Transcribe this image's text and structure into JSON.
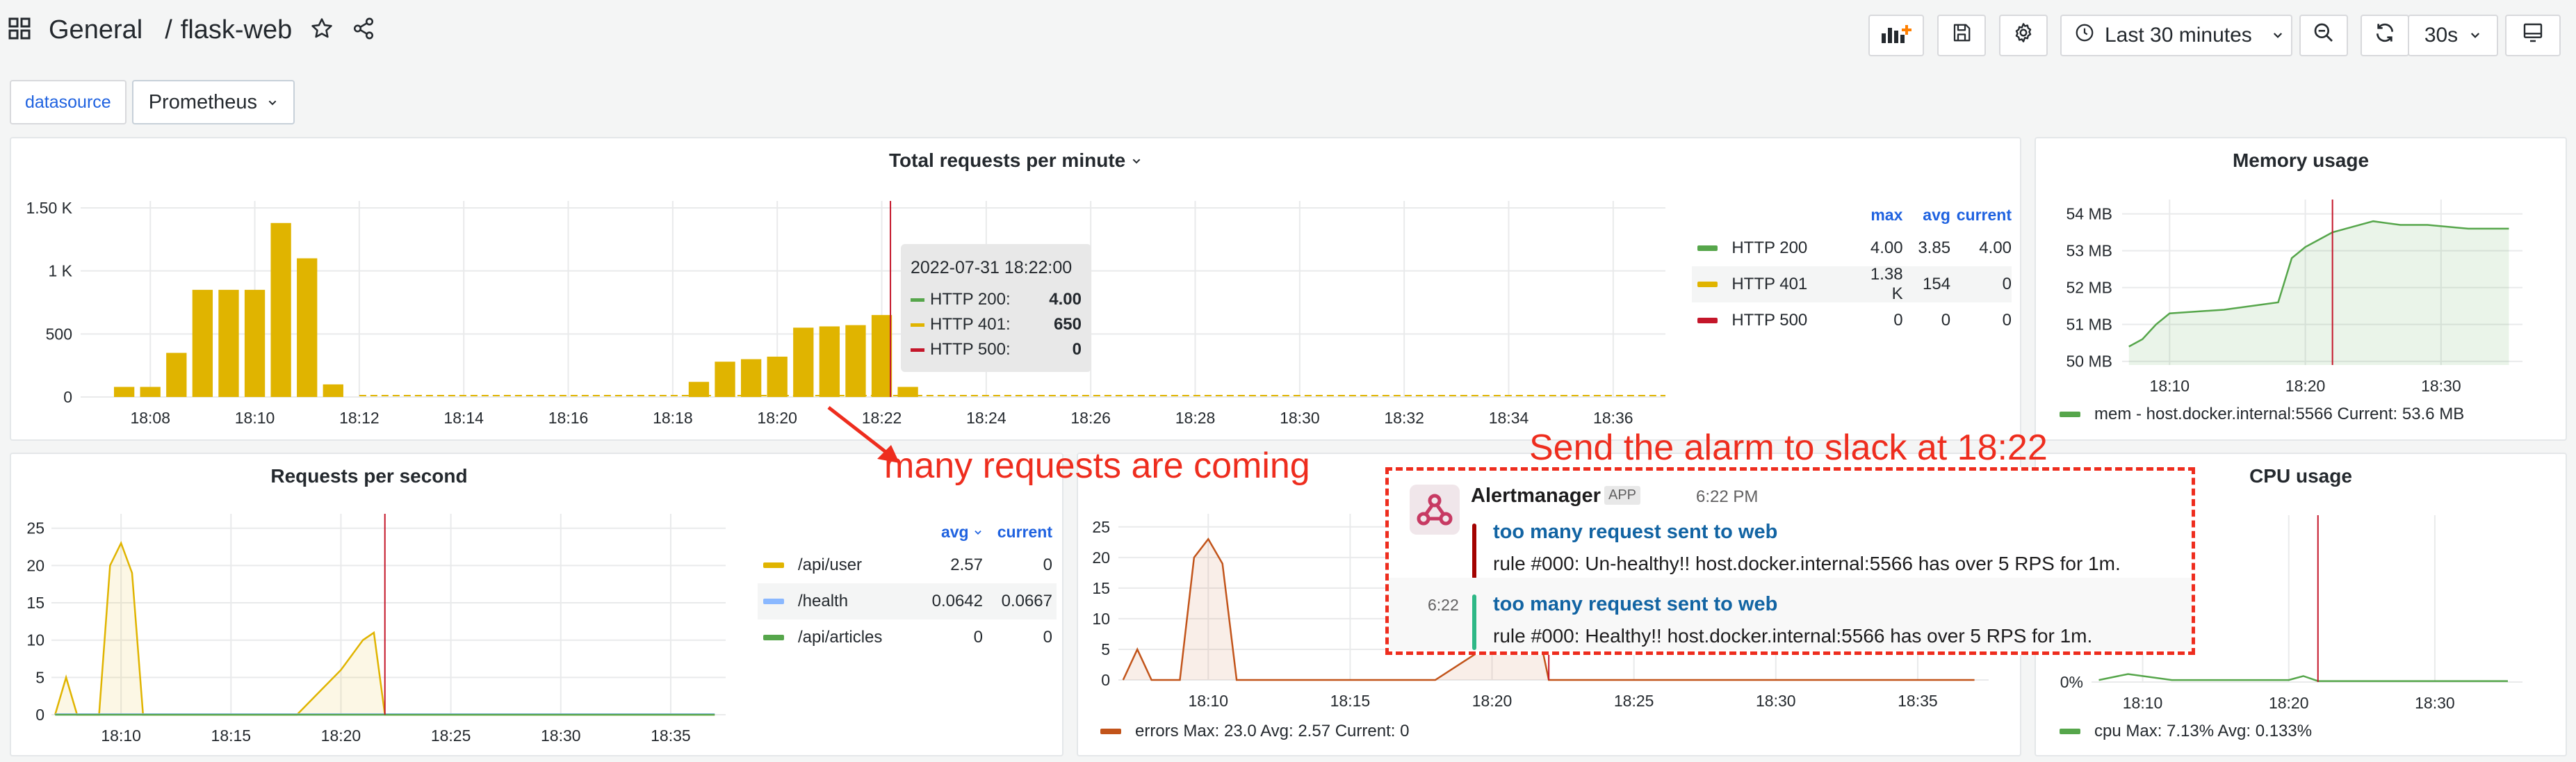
{
  "header": {
    "folder": "General",
    "separator": "/",
    "dashboard": "flask-web",
    "time_range": "Last 30 minutes",
    "refresh": "30s"
  },
  "variables": {
    "label": "datasource",
    "value": "Prometheus"
  },
  "icons": [
    "apps-icon",
    "star-icon",
    "share-icon",
    "add-panel-icon",
    "save-icon",
    "gear-icon",
    "clock-icon",
    "chevron-down-icon",
    "zoom-out-icon",
    "refresh-icon",
    "tv-icon"
  ],
  "panels": {
    "total_requests": {
      "title": "Total requests per minute",
      "legend": {
        "headers": [
          "max",
          "avg",
          "current"
        ],
        "rows": [
          {
            "name": "HTTP 200",
            "max": "4.00",
            "avg": "3.85",
            "current": "4.00",
            "color": "#56a64b"
          },
          {
            "name": "HTTP 401",
            "max": "1.38 K",
            "avg": "154",
            "current": "0",
            "color": "#e0b400"
          },
          {
            "name": "HTTP 500",
            "max": "0",
            "avg": "0",
            "current": "0",
            "color": "#c4162a"
          }
        ]
      },
      "tooltip": {
        "time": "2022-07-31 18:22:00",
        "rows": [
          {
            "label": "HTTP 200:",
            "value": "4.00",
            "color": "#56a64b"
          },
          {
            "label": "HTTP 401:",
            "value": "650",
            "color": "#e0b400"
          },
          {
            "label": "HTTP 500:",
            "value": "0",
            "color": "#c4162a"
          }
        ]
      }
    },
    "memory": {
      "title": "Memory usage",
      "legend": "mem - host.docker.internal:5566  Current: 53.6 MB"
    },
    "rps": {
      "title": "Requests per second",
      "legend": {
        "headers": [
          "avg",
          "current"
        ],
        "rows": [
          {
            "name": "/api/user",
            "avg": "2.57",
            "current": "0",
            "color": "#e0b400"
          },
          {
            "name": "/health",
            "avg": "0.0642",
            "current": "0.0667",
            "color": "#8ab8ff"
          },
          {
            "name": "/api/articles",
            "avg": "0",
            "current": "0",
            "color": "#56a64b"
          }
        ]
      }
    },
    "errors": {
      "legend": "errors  Max: 23.0  Avg: 2.57  Current: 0"
    },
    "cpu": {
      "title": "CPU usage",
      "legend": "cpu  Max: 7.13%  Avg: 0.133%"
    }
  },
  "annotations": {
    "arrow_text": "many requests are coming",
    "slack_text": "Send the alarm to slack at 18:22"
  },
  "slack": {
    "sender": "Alertmanager",
    "badge": "APP",
    "time": "6:22 PM",
    "messages": [
      {
        "title": "too many request sent to web",
        "body": "rule #000:  Un-healthy!!  host.docker.internal:5566 has over 5 RPS for 1m.",
        "bar_color": "#a30200",
        "stamp": ""
      },
      {
        "title": "too many request sent to web",
        "body": "rule #000:  Healthy!!  host.docker.internal:5566 has over 5 RPS for 1m.",
        "bar_color": "#2eb886",
        "stamp": "6:22"
      }
    ]
  },
  "chart_data": [
    {
      "type": "bar",
      "title": "Total requests per minute",
      "x_ticks": [
        "18:08",
        "18:10",
        "18:12",
        "18:14",
        "18:16",
        "18:18",
        "18:20",
        "18:22",
        "18:24",
        "18:26",
        "18:28",
        "18:30",
        "18:32",
        "18:34",
        "18:36"
      ],
      "y_ticks": [
        "0",
        "500",
        "1 K",
        "1.50 K"
      ],
      "ylim": [
        0,
        1500
      ],
      "series": [
        {
          "name": "HTTP 401",
          "color": "#e0b400",
          "x": [
            "18:07:30",
            "18:08:00",
            "18:08:30",
            "18:09:00",
            "18:09:30",
            "18:10:00",
            "18:10:30",
            "18:11:00",
            "18:11:30",
            "18:18:30",
            "18:19:00",
            "18:19:30",
            "18:20:00",
            "18:20:30",
            "18:21:00",
            "18:21:30",
            "18:22:00",
            "18:22:30"
          ],
          "values": [
            80,
            80,
            350,
            850,
            850,
            850,
            1380,
            1100,
            100,
            120,
            280,
            300,
            320,
            550,
            560,
            570,
            650,
            80
          ]
        }
      ]
    },
    {
      "type": "area",
      "title": "Memory usage",
      "x_ticks": [
        "18:10",
        "18:20",
        "18:30"
      ],
      "y_ticks": [
        "50 MB",
        "51 MB",
        "52 MB",
        "53 MB",
        "54 MB"
      ],
      "ylim": [
        49.9,
        54.2
      ],
      "series": [
        {
          "name": "mem - host.docker.internal:5566",
          "color": "#56a64b",
          "x": [
            "18:07",
            "18:08",
            "18:09",
            "18:10",
            "18:14",
            "18:18",
            "18:19",
            "18:20",
            "18:21",
            "18:22",
            "18:23",
            "18:25",
            "18:27",
            "18:29",
            "18:32",
            "18:35"
          ],
          "values": [
            50.4,
            50.6,
            51.0,
            51.3,
            51.4,
            51.6,
            52.8,
            53.1,
            53.3,
            53.5,
            53.6,
            53.8,
            53.7,
            53.7,
            53.6,
            53.6
          ]
        }
      ]
    },
    {
      "type": "area",
      "title": "Requests per second",
      "x_ticks": [
        "18:10",
        "18:15",
        "18:20",
        "18:25",
        "18:30",
        "18:35"
      ],
      "y_ticks": [
        "0",
        "5",
        "10",
        "15",
        "20",
        "25"
      ],
      "ylim": [
        0,
        26
      ],
      "series": [
        {
          "name": "/api/user",
          "color": "#e0b400",
          "x": [
            "18:07",
            "18:07.5",
            "18:08",
            "18:09",
            "18:09.5",
            "18:10",
            "18:10.5",
            "18:11",
            "18:12",
            "18:18",
            "18:19",
            "18:20",
            "18:21",
            "18:21.5",
            "18:22",
            "18:23",
            "18:37"
          ],
          "values": [
            0,
            5,
            0,
            0,
            20,
            23,
            19,
            0,
            0,
            0,
            3,
            6,
            10,
            11,
            0,
            0,
            0
          ]
        },
        {
          "name": "/health",
          "color": "#8ab8ff",
          "x": [
            "18:07",
            "18:37"
          ],
          "values": [
            0.07,
            0.07
          ]
        },
        {
          "name": "/api/articles",
          "color": "#56a64b",
          "x": [
            "18:07",
            "18:37"
          ],
          "values": [
            0,
            0
          ]
        }
      ]
    },
    {
      "type": "area",
      "x_ticks": [
        "18:10",
        "18:15",
        "18:20",
        "18:25",
        "18:30",
        "18:35"
      ],
      "y_ticks": [
        "0",
        "5",
        "10",
        "15",
        "20",
        "25"
      ],
      "ylim": [
        0,
        26
      ],
      "series": [
        {
          "name": "errors",
          "color": "#c2541a",
          "x": [
            "18:07",
            "18:07.5",
            "18:08",
            "18:09",
            "18:09.5",
            "18:10",
            "18:10.5",
            "18:11",
            "18:12",
            "18:18",
            "18:19",
            "18:20",
            "18:21",
            "18:21.5",
            "18:22",
            "18:23",
            "18:37"
          ],
          "values": [
            0,
            5,
            0,
            0,
            20,
            23,
            19,
            0,
            0,
            0,
            3,
            6,
            10,
            11,
            0,
            0,
            0
          ]
        }
      ]
    },
    {
      "type": "line",
      "title": "CPU usage",
      "x_ticks": [
        "18:10",
        "18:20",
        "18:30"
      ],
      "y_ticks": [
        "0%"
      ],
      "ylim": [
        0,
        8
      ],
      "series": [
        {
          "name": "cpu",
          "color": "#56a64b",
          "x": [
            "18:07",
            "18:09",
            "18:10",
            "18:12",
            "18:20",
            "18:21",
            "18:22",
            "18:35"
          ],
          "values": [
            0.1,
            0.4,
            0.3,
            0.1,
            0.1,
            0.3,
            0.05,
            0.05
          ]
        }
      ]
    }
  ]
}
